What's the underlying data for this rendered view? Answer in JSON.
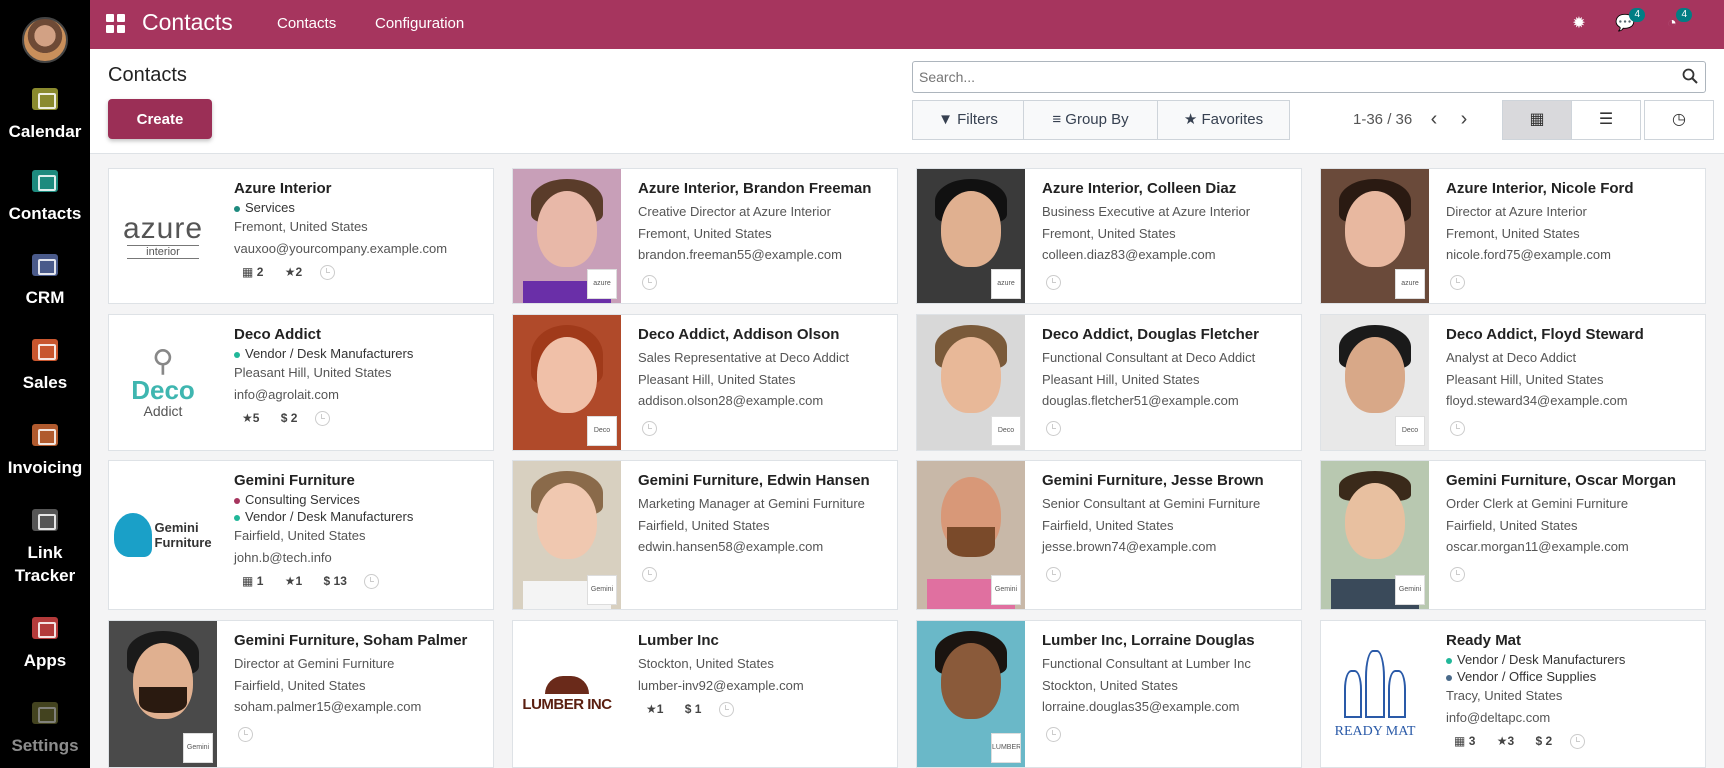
{
  "sidebar": {
    "items": [
      {
        "label": "Calendar",
        "icon": "calendar-icon",
        "color": "#8a8a2e"
      },
      {
        "label": "Contacts",
        "icon": "contacts-icon",
        "color": "#1d8a7e"
      },
      {
        "label": "CRM",
        "icon": "crm-icon",
        "color": "#4a5a8a"
      },
      {
        "label": "Sales",
        "icon": "sales-icon",
        "color": "#c8562e"
      },
      {
        "label": "Invoicing",
        "icon": "invoicing-icon",
        "color": "#b05a2e"
      },
      {
        "label": "Link",
        "label2": "Tracker",
        "icon": "link-tracker-icon",
        "color": "#555"
      },
      {
        "label": "Apps",
        "icon": "apps-icon",
        "color": "#b33a3a"
      },
      {
        "label": "Settings",
        "icon": "settings-icon",
        "color": "#7a7a3a"
      }
    ]
  },
  "topbar": {
    "app_name": "Contacts",
    "menu": [
      "Contacts",
      "Configuration"
    ],
    "messages_count": "4",
    "activities_count": "4"
  },
  "control_panel": {
    "title": "Contacts",
    "create_label": "Create",
    "search_placeholder": "Search...",
    "filters_label": "Filters",
    "groupby_label": "Group By",
    "favorites_label": "Favorites",
    "pager": "1-36 / 36"
  },
  "cards": [
    {
      "title": "Azure Interior",
      "tags": [
        "Services"
      ],
      "lines": [
        "Fremont, United States",
        "vauxoo@yourcompany.example.com"
      ],
      "stats": [
        "2",
        "2"
      ]
    },
    {
      "title": "Azure Interior, Brandon Freeman",
      "lines": [
        "Creative Director at Azure Interior",
        "Fremont, United States",
        "brandon.freeman55@example.com"
      ]
    },
    {
      "title": "Azure Interior, Colleen Diaz",
      "lines": [
        "Business Executive at Azure Interior",
        "Fremont, United States",
        "colleen.diaz83@example.com"
      ]
    },
    {
      "title": "Azure Interior, Nicole Ford",
      "lines": [
        "Director at Azure Interior",
        "Fremont, United States",
        "nicole.ford75@example.com"
      ]
    },
    {
      "title": "Deco Addict",
      "tags": [
        "Vendor / Desk Manufacturers"
      ],
      "lines": [
        "Pleasant Hill, United States",
        "info@agrolait.com"
      ],
      "stats": [
        "5",
        "$ 2"
      ]
    },
    {
      "title": "Deco Addict, Addison Olson",
      "lines": [
        "Sales Representative at Deco Addict",
        "Pleasant Hill, United States",
        "addison.olson28@example.com"
      ]
    },
    {
      "title": "Deco Addict, Douglas Fletcher",
      "lines": [
        "Functional Consultant at Deco Addict",
        "Pleasant Hill, United States",
        "douglas.fletcher51@example.com"
      ]
    },
    {
      "title": "Deco Addict, Floyd Steward",
      "lines": [
        "Analyst at Deco Addict",
        "Pleasant Hill, United States",
        "floyd.steward34@example.com"
      ]
    },
    {
      "title": "Gemini Furniture",
      "tags": [
        "Consulting Services",
        "Vendor / Desk Manufacturers"
      ],
      "lines": [
        "Fairfield, United States",
        "john.b@tech.info"
      ],
      "stats": [
        "1",
        "1",
        "$ 13"
      ]
    },
    {
      "title": "Gemini Furniture, Edwin Hansen",
      "lines": [
        "Marketing Manager at Gemini Furniture",
        "Fairfield, United States",
        "edwin.hansen58@example.com"
      ]
    },
    {
      "title": "Gemini Furniture, Jesse Brown",
      "lines": [
        "Senior Consultant at Gemini Furniture",
        "Fairfield, United States",
        "jesse.brown74@example.com"
      ]
    },
    {
      "title": "Gemini Furniture, Oscar Morgan",
      "lines": [
        "Order Clerk at Gemini Furniture",
        "Fairfield, United States",
        "oscar.morgan11@example.com"
      ]
    },
    {
      "title": "Gemini Furniture, Soham Palmer",
      "lines": [
        "Director at Gemini Furniture",
        "Fairfield, United States",
        "soham.palmer15@example.com"
      ]
    },
    {
      "title": "Lumber Inc",
      "lines": [
        "Stockton, United States",
        "lumber-inv92@example.com"
      ],
      "stats": [
        "1",
        "$ 1"
      ]
    },
    {
      "title": "Lumber Inc, Lorraine Douglas",
      "lines": [
        "Functional Consultant at Lumber Inc",
        "Stockton, United States",
        "lorraine.douglas35@example.com"
      ]
    },
    {
      "title": "Ready Mat",
      "tags": [
        "Vendor / Desk Manufacturers",
        "Vendor / Office Supplies"
      ],
      "lines": [
        "Tracy, United States",
        "info@deltapc.com"
      ],
      "stats": [
        "3",
        "3",
        "$ 2"
      ]
    }
  ],
  "logos": {
    "azure": "azure",
    "azure_sub": "interior",
    "deco": "Deco",
    "deco_sub": "Addict",
    "gemini": "Gemini Furniture",
    "lumber": "LUMBER INC",
    "readymat": "READY MAT"
  },
  "colors": {
    "brand": "#a6355e",
    "create": "#9b2f56",
    "tag_services": "#1d8a7e",
    "tag_vendor": "#21b799",
    "tag_consulting": "#a6355e",
    "tag_office": "#4a6a8a"
  }
}
